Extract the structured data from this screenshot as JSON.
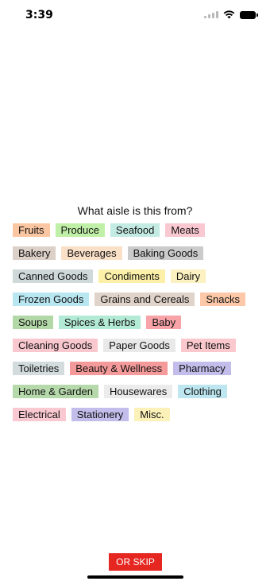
{
  "status_bar": {
    "time": "3:39"
  },
  "question": "What aisle is this from?",
  "aisles": [
    {
      "label": "Fruits",
      "color": "#fbc7a2"
    },
    {
      "label": "Produce",
      "color": "#c0f0a8"
    },
    {
      "label": "Seafood",
      "color": "#c4ebe3"
    },
    {
      "label": "Meats",
      "color": "#f9c8d0"
    },
    {
      "label": "Bakery",
      "color": "#ddd0c8"
    },
    {
      "label": "Beverages",
      "color": "#fbe0c8"
    },
    {
      "label": "Baking Goods",
      "color": "#cbcbcb"
    },
    {
      "label": "Canned Goods",
      "color": "#cfd9d9"
    },
    {
      "label": "Condiments",
      "color": "#fcf0a8"
    },
    {
      "label": "Dairy",
      "color": "#fcf1c0"
    },
    {
      "label": "Frozen Goods",
      "color": "#b8e6f1"
    },
    {
      "label": "Grains and Cereals",
      "color": "#e0d3c9"
    },
    {
      "label": "Snacks",
      "color": "#fcc8a8"
    },
    {
      "label": "Soups",
      "color": "#b3d8a8"
    },
    {
      "label": "Spices & Herbs",
      "color": "#b3ead6"
    },
    {
      "label": "Baby",
      "color": "#f7a3a8"
    },
    {
      "label": "Cleaning Goods",
      "color": "#f9c8cf"
    },
    {
      "label": "Paper Goods",
      "color": "#e9e9e9"
    },
    {
      "label": "Pet Items",
      "color": "#fac8cd"
    },
    {
      "label": "Toiletries",
      "color": "#d3dcdc"
    },
    {
      "label": "Beauty & Wellness",
      "color": "#f59a9a"
    },
    {
      "label": "Pharmacy",
      "color": "#c2bdea"
    },
    {
      "label": "Home & Garden",
      "color": "#b6d9ab"
    },
    {
      "label": "Housewares",
      "color": "#ececec"
    },
    {
      "label": "Clothing",
      "color": "#bde6f1"
    },
    {
      "label": "Electrical",
      "color": "#f9c8d0"
    },
    {
      "label": "Stationery",
      "color": "#c2bdea"
    },
    {
      "label": "Misc.",
      "color": "#fcf1b8"
    }
  ],
  "skip_button": {
    "label": "OR SKIP",
    "color": "#e52621"
  }
}
